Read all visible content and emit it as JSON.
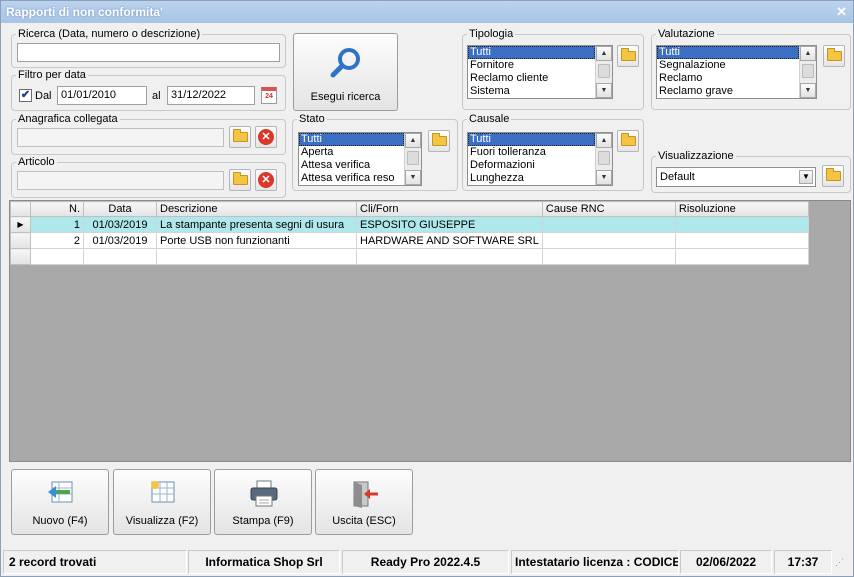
{
  "window": {
    "title": "Rapporti di non conformita'",
    "close_icon": "close-icon"
  },
  "ricerca": {
    "legend": "Ricerca (Data, numero o descrizione)",
    "value": ""
  },
  "filtro": {
    "legend": "Filtro per data",
    "dal_label": "Dal",
    "dal_checked": true,
    "dal_value": "01/01/2010",
    "al_label": "al",
    "al_value": "31/12/2022",
    "calendar_text": "24"
  },
  "esegui": {
    "label": "Esegui ricerca"
  },
  "anagrafica": {
    "legend": "Anagrafica collegata",
    "value": ""
  },
  "articolo": {
    "legend": "Articolo",
    "value": ""
  },
  "stato": {
    "legend": "Stato",
    "items": [
      "Tutti",
      "Aperta",
      "Attesa verifica",
      "Attesa verifica reso"
    ]
  },
  "tipologia": {
    "legend": "Tipologia",
    "items": [
      "Tutti",
      "Fornitore",
      "Reclamo cliente",
      "Sistema"
    ]
  },
  "causale": {
    "legend": "Causale",
    "items": [
      "Tutti",
      "Fuori tolleranza",
      "Deformazioni",
      "Lunghezza"
    ]
  },
  "valutazione": {
    "legend": "Valutazione",
    "items": [
      "Tutti",
      "Segnalazione",
      "Reclamo",
      "Reclamo grave"
    ]
  },
  "visualizzazione": {
    "legend": "Visualizzazione",
    "value": "Default"
  },
  "grid": {
    "columns": [
      "N.",
      "Data",
      "Descrizione",
      "Cli/Forn",
      "Cause RNC",
      "Risoluzione"
    ],
    "rows": [
      [
        "1",
        "01/03/2019",
        "La stampante presenta segni di usura",
        "ESPOSITO GIUSEPPE",
        "",
        ""
      ],
      [
        "2",
        "01/03/2019",
        "Porte USB non funzionanti",
        "HARDWARE AND SOFTWARE SRL",
        "",
        ""
      ]
    ],
    "current_row_indicator": "▶"
  },
  "buttons": {
    "nuovo": "Nuovo (F4)",
    "visualizza": "Visualizza (F2)",
    "stampa": "Stampa (F9)",
    "uscita": "Uscita (ESC)"
  },
  "status": {
    "records": "2 record trovati",
    "company": "Informatica Shop Srl",
    "version": "Ready Pro 2022.4.5",
    "license": "Intestatario licenza : CODICE",
    "date": "02/06/2022",
    "time": "17:37"
  },
  "colors": {
    "titlebar": "#a8c4e6",
    "selection": "#3b6fc4",
    "current_row": "#aee8ec",
    "grid_background": "#a9a9a9"
  }
}
